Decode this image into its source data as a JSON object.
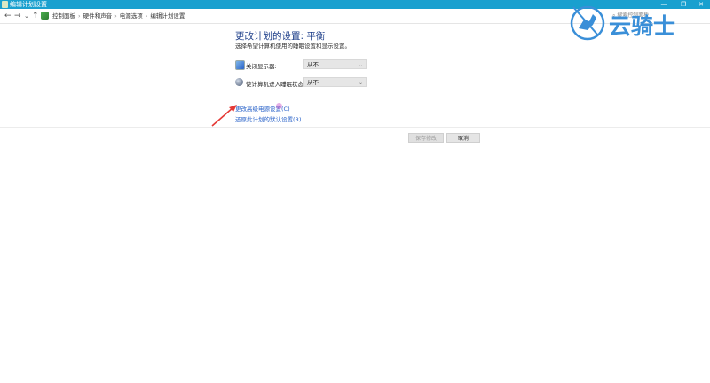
{
  "window": {
    "title": "编辑计划设置",
    "controls": {
      "minimize": "—",
      "maximize": "❐",
      "close": "✕"
    }
  },
  "nav": {
    "back": "←",
    "forward": "→",
    "recent": "⌄",
    "up": "↑",
    "breadcrumb": [
      "控制面板",
      "硬件和声音",
      "电源选项",
      "编辑计划设置"
    ],
    "search_placeholder": "搜索控制面板"
  },
  "main": {
    "title": "更改计划的设置: 平衡",
    "subtitle": "选择希望计算机使用的睡眠设置和显示设置。",
    "rows": [
      {
        "label": "关闭显示器:",
        "value": "从不",
        "icon": "monitor-icon"
      },
      {
        "label": "使计算机进入睡眠状态:",
        "value": "从不",
        "icon": "moon-icon"
      }
    ],
    "links": {
      "advanced": "更改高级电源设置(C)",
      "restore": "还原此计划的默认设置(R)"
    },
    "buttons": {
      "save": "保存修改",
      "cancel": "取消"
    }
  },
  "watermark": {
    "text": "云骑士"
  },
  "colors": {
    "titlebar": "#19a0cf",
    "title_text": "#1e3f8a",
    "link": "#2a63c9",
    "annotation_arrow": "#e53935"
  }
}
